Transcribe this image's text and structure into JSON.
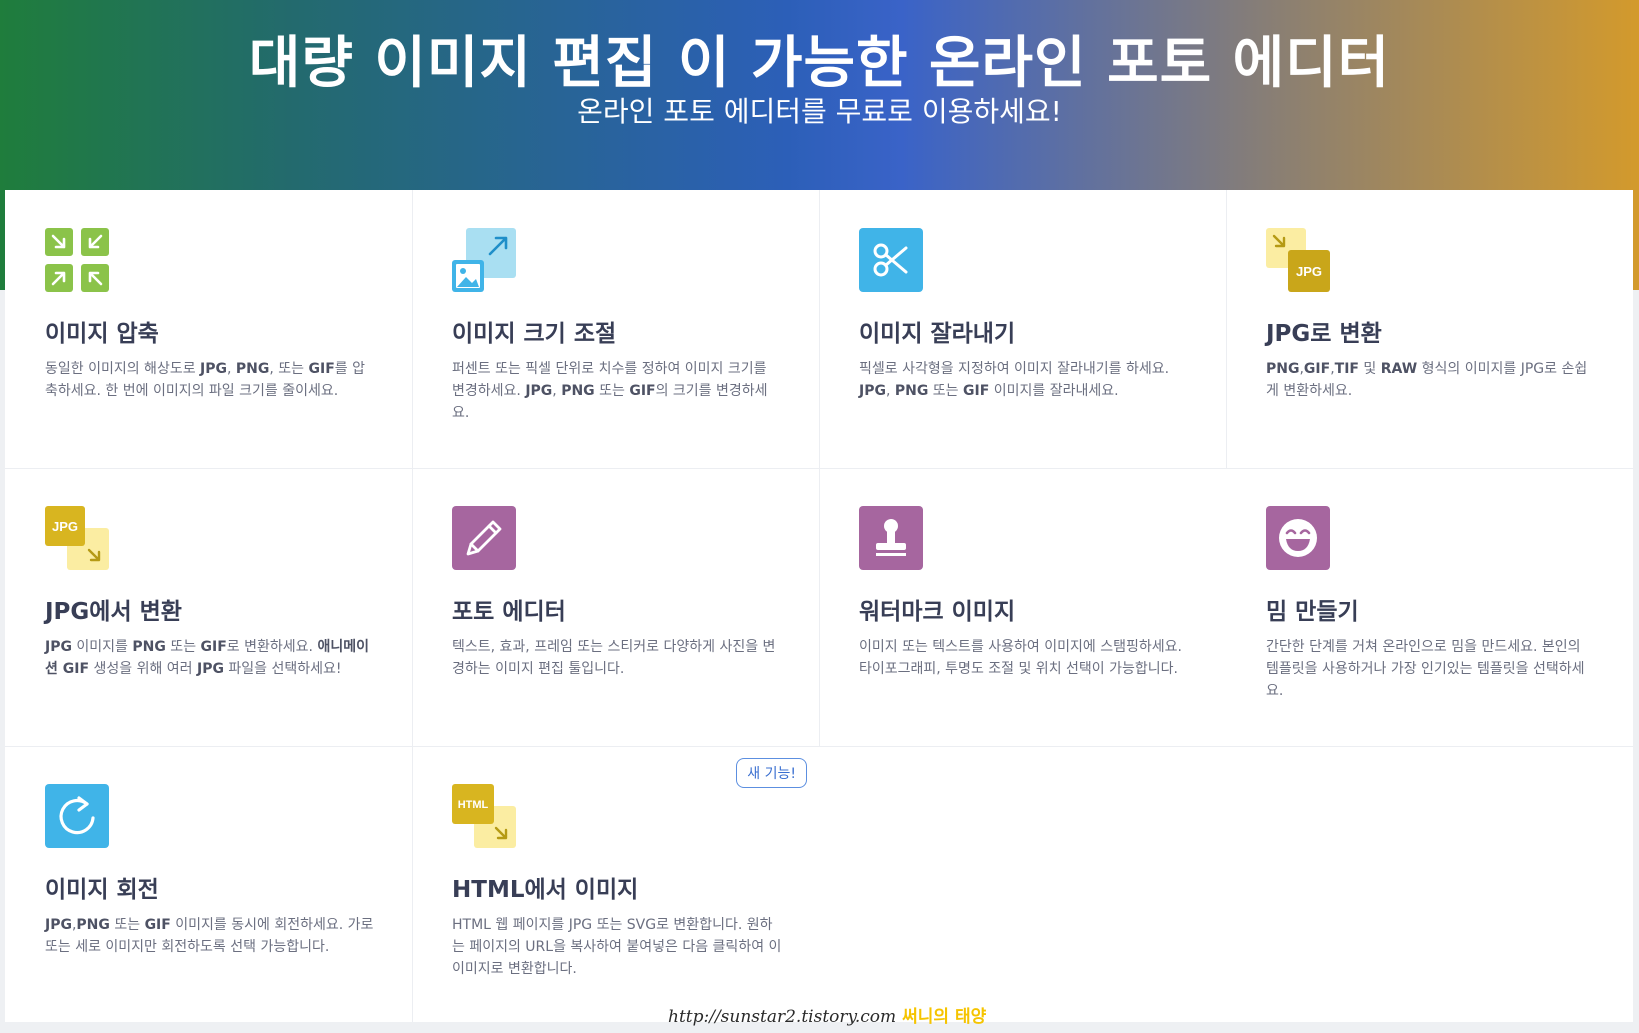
{
  "header": {
    "title": "대량 이미지 편집 이 가능한 온라인 포토 에디터",
    "subtitle": "온라인 포토 에디터를 무료로 이용하세요!"
  },
  "tools": [
    {
      "icon": "compress-arrows-icon",
      "title": "이미지 압축",
      "desc_parts": [
        {
          "t": "동일한 이미지의 해상도로 "
        },
        {
          "t": "JPG",
          "b": true
        },
        {
          "t": ", "
        },
        {
          "t": "PNG",
          "b": true
        },
        {
          "t": ", 또는 "
        },
        {
          "t": "GIF",
          "b": true
        },
        {
          "t": "를 압축하세요. 한 번에 이미지의 파일 크기를 줄이세요."
        }
      ]
    },
    {
      "icon": "resize-image-icon",
      "title": "이미지 크기 조절",
      "desc_parts": [
        {
          "t": "퍼센트 또는 픽셀 단위로 치수를 정하여 이미지 크기를 변경하세요. "
        },
        {
          "t": "JPG",
          "b": true
        },
        {
          "t": ", "
        },
        {
          "t": "PNG",
          "b": true
        },
        {
          "t": " 또는 "
        },
        {
          "t": "GIF",
          "b": true
        },
        {
          "t": "의 크기를 변경하세요."
        }
      ]
    },
    {
      "icon": "scissors-icon",
      "title": "이미지 잘라내기",
      "desc_parts": [
        {
          "t": "픽셀로 사각형을 지정하여 이미지 잘라내기를 하세요. "
        },
        {
          "t": "JPG",
          "b": true
        },
        {
          "t": ", "
        },
        {
          "t": "PNG",
          "b": true
        },
        {
          "t": " 또는 "
        },
        {
          "t": "GIF",
          "b": true
        },
        {
          "t": " 이미지를 잘라내세요."
        }
      ]
    },
    {
      "icon": "convert-to-jpg-icon",
      "icon_label": "JPG",
      "title": "JPG로 변환",
      "desc_parts": [
        {
          "t": "PNG",
          "b": true
        },
        {
          "t": ","
        },
        {
          "t": "GIF",
          "b": true
        },
        {
          "t": ","
        },
        {
          "t": "TIF",
          "b": true
        },
        {
          "t": " 및 "
        },
        {
          "t": "RAW",
          "b": true
        },
        {
          "t": " 형식의 이미지를 JPG로 손쉽게 변환하세요."
        }
      ]
    },
    {
      "icon": "convert-from-jpg-icon",
      "icon_label": "JPG",
      "title": "JPG에서 변환",
      "desc_parts": [
        {
          "t": "JPG",
          "b": true
        },
        {
          "t": " 이미지를 "
        },
        {
          "t": "PNG",
          "b": true
        },
        {
          "t": " 또는 "
        },
        {
          "t": "GIF",
          "b": true
        },
        {
          "t": "로 변환하세요. "
        },
        {
          "t": "애니메이션 ",
          "b": true
        },
        {
          "t": "GIF",
          "b": true
        },
        {
          "t": " 생성을 위해 여러 "
        },
        {
          "t": "JPG",
          "b": true
        },
        {
          "t": " 파일을 선택하세요!"
        }
      ]
    },
    {
      "icon": "pencil-icon",
      "title": "포토 에디터",
      "desc_parts": [
        {
          "t": "텍스트, 효과, 프레임 또는 스티커로 다양하게 사진을 변경하는 이미지 편집 툴입니다."
        }
      ]
    },
    {
      "icon": "stamp-icon",
      "title": "워터마크 이미지",
      "desc_parts": [
        {
          "t": "이미지 또는 텍스트를 사용하여 이미지에 스탬핑하세요. 타이포그래피, 투명도 조절 및 위치 선택이 가능합니다."
        }
      ]
    },
    {
      "icon": "laughing-face-icon",
      "title": "밈 만들기",
      "desc_parts": [
        {
          "t": "간단한 단계를 거쳐 온라인으로 밈을 만드세요. 본인의 템플릿을 사용하거나 가장 인기있는 템플릿을 선택하세요."
        }
      ]
    },
    {
      "icon": "rotate-icon",
      "title": "이미지 회전",
      "desc_parts": [
        {
          "t": "JPG",
          "b": true
        },
        {
          "t": ","
        },
        {
          "t": "PNG",
          "b": true
        },
        {
          "t": " 또는 "
        },
        {
          "t": "GIF",
          "b": true
        },
        {
          "t": " 이미지를 동시에 회전하세요. 가로 또는 세로 이미지만 회전하도록 선택 가능합니다."
        }
      ]
    },
    {
      "icon": "html-to-image-icon",
      "icon_label": "HTML",
      "title": "HTML에서 이미지",
      "badge": "새 기능!",
      "desc_parts": [
        {
          "t": "HTML 웹 페이지를 JPG 또는 SVG로 변환합니다. 원하는 페이지의 URL을 복사하여 붙여넣은 다음 클릭하여 이이미지로 변환합니다."
        }
      ]
    }
  ],
  "watermark": {
    "url": "http://sunstar2.tistory.com",
    "name": "써니의 태양"
  },
  "colors": {
    "green_icon": "#8bc34a",
    "blue_icon": "#40b4e8",
    "yellow_icon": "#d8b520",
    "purple_icon": "#a6669f"
  }
}
